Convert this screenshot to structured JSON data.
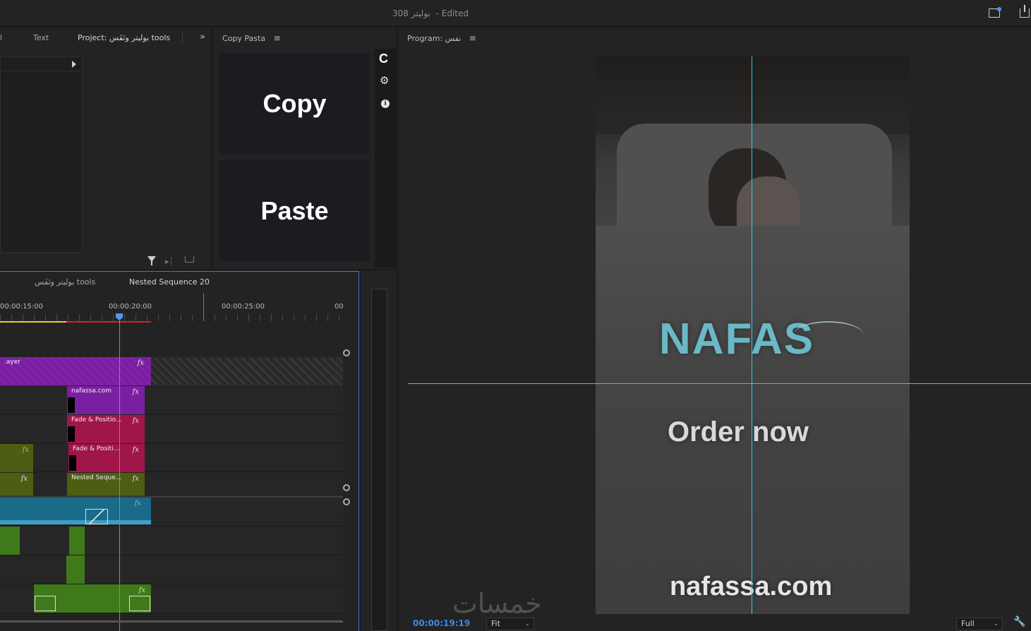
{
  "window": {
    "title_name": "بوليتر 308",
    "title_status": "- Edited"
  },
  "project_panel": {
    "tabs": [
      "l",
      "Text",
      "Project: بوليتر ونَفَس tools"
    ],
    "more_icon": "double-chevron-right-icon"
  },
  "copy_pasta": {
    "title": "Copy Pasta",
    "copy_label": "Copy",
    "paste_label": "Paste",
    "side_icons": [
      "c-logo-icon",
      "gear-icon",
      "info-icon"
    ]
  },
  "timeline": {
    "tabs": [
      "بوليتر ونَفَس tools",
      "Nested Sequence 20"
    ],
    "ruler_labels": [
      "00:00:15:00",
      "00:00:20:00",
      "00:00:25:00",
      "00"
    ],
    "clips": {
      "layer": ".ayer",
      "nafassa": "nafassa.com",
      "fade1": "Fade & Positio...",
      "fade2": "Fade & Positi...",
      "nested": "Nested Seque...",
      "fx": "fx"
    },
    "colors": {
      "purple": "#7b1fa2",
      "crimson": "#a0164a",
      "olive": "#4d5d13",
      "teal": "#1a6a8a",
      "green": "#3f7a1a",
      "playhead": "#4a9be8"
    }
  },
  "program": {
    "title": "Program: نفس",
    "timecode": "00:00:19:19",
    "fit_label": "Fit",
    "quality_label": "Full",
    "video": {
      "logo_text": "NAFAS",
      "cta_text": "Order now",
      "url_text": "nafassa.com"
    },
    "watermark": "خمسات",
    "guide_color": "#3fc6d8"
  }
}
